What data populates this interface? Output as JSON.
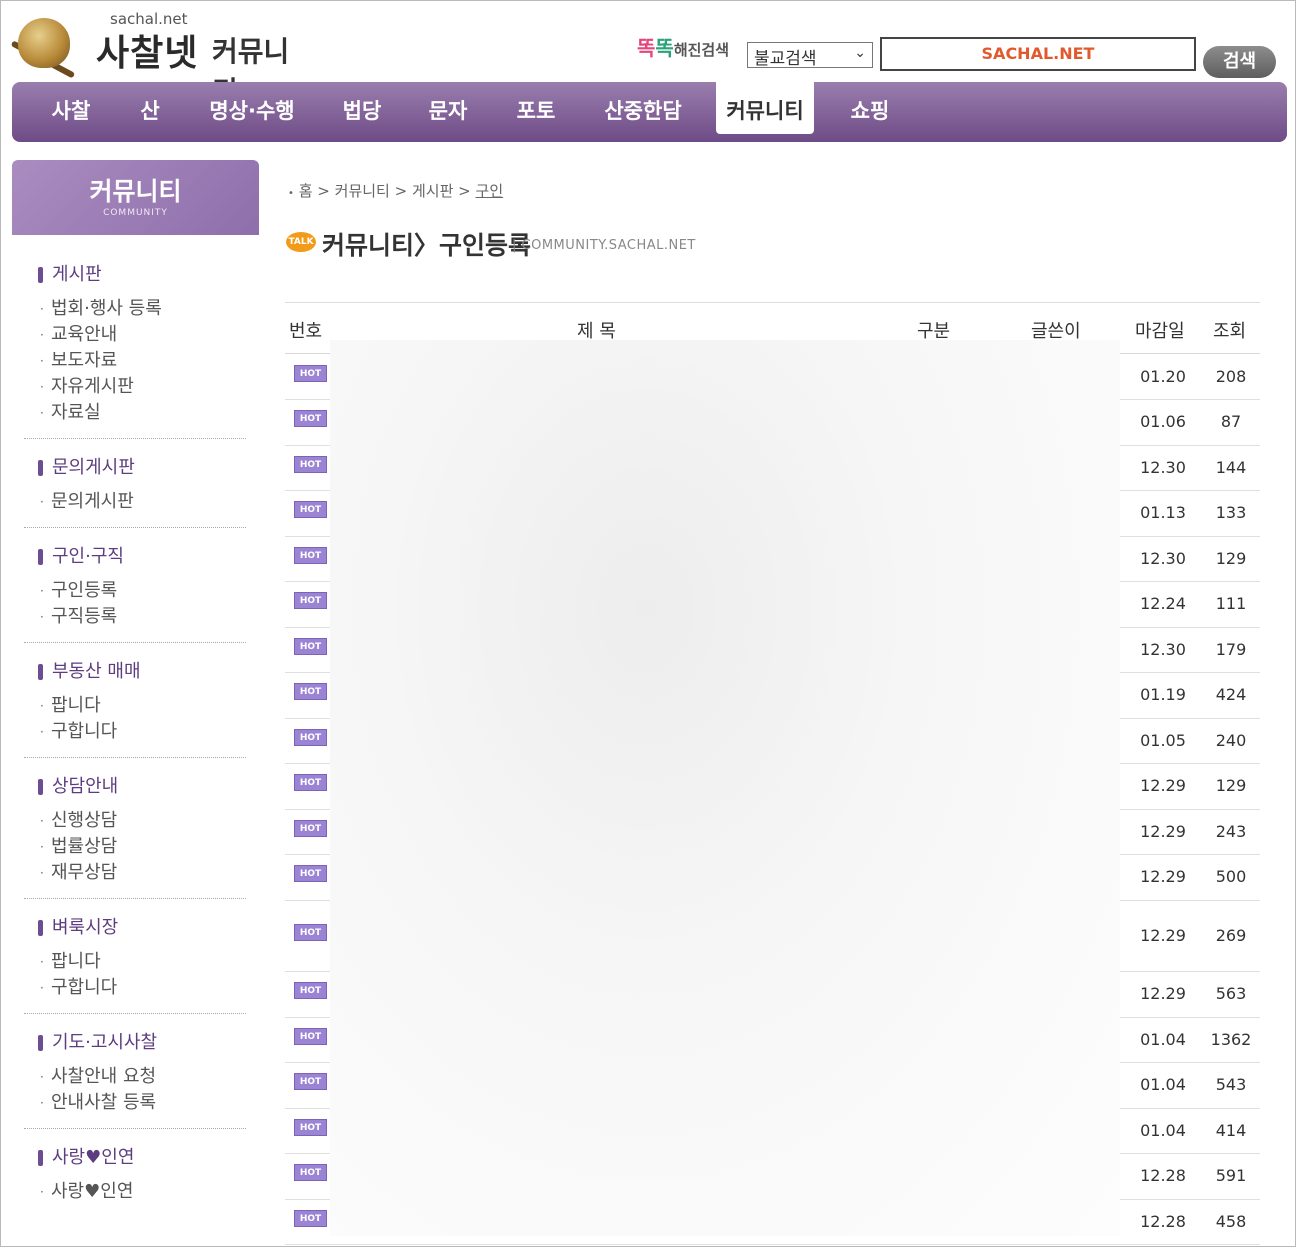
{
  "header": {
    "logo_small": "sachal.net",
    "logo_main": "사찰넷",
    "logo_sub": "커뮤니티",
    "search_brand_tok1": "똑",
    "search_brand_tok2": "똑",
    "search_brand_text": "해진검색",
    "search_select_value": "불교검색",
    "search_input_value": "SACHAL.NET",
    "search_button": "검색"
  },
  "nav": [
    "사찰",
    "산",
    "명상·수행",
    "법당",
    "문자",
    "포토",
    "산중한담",
    "커뮤니티",
    "쇼핑"
  ],
  "sidebar": {
    "banner_title": "커뮤니티",
    "banner_sub": "COMMUNITY",
    "sections": [
      {
        "title": "게시판",
        "items": [
          "법회·행사 등록",
          "교육안내",
          "보도자료",
          "자유게시판",
          "자료실"
        ]
      },
      {
        "title": "문의게시판",
        "items": [
          "문의게시판"
        ]
      },
      {
        "title": "구인·구직",
        "items": [
          "구인등록",
          "구직등록"
        ]
      },
      {
        "title": "부동산 매매",
        "items": [
          "팝니다",
          "구합니다"
        ]
      },
      {
        "title": "상담안내",
        "items": [
          "신행상담",
          "법률상담",
          "재무상담"
        ]
      },
      {
        "title": "벼룩시장",
        "items": [
          "팝니다",
          "구합니다"
        ]
      },
      {
        "title": "기도·고시사찰",
        "items": [
          "사찰안내 요청",
          "안내사찰 등록"
        ]
      },
      {
        "title": "사랑♥인연",
        "items": [
          "사랑♥인연"
        ]
      }
    ]
  },
  "breadcrumb": {
    "bullet": "•",
    "home": "홈",
    "sep": ">",
    "c1": "커뮤니티",
    "c2": "게시판",
    "c3": "구인"
  },
  "page": {
    "talk": "TALK",
    "title": "커뮤니티〉구인등록",
    "sub": "|  COMMUNITY.SACHAL.NET"
  },
  "table": {
    "headers": {
      "no": "번호",
      "title": "제  목",
      "category": "구분",
      "writer": "글쓴이",
      "deadline": "마감일",
      "views": "조회"
    },
    "badge": "HOT",
    "rows": [
      {
        "deadline": "01.20",
        "views": "208"
      },
      {
        "deadline": "01.06",
        "views": "87"
      },
      {
        "deadline": "12.30",
        "views": "144"
      },
      {
        "deadline": "01.13",
        "views": "133"
      },
      {
        "deadline": "12.30",
        "views": "129"
      },
      {
        "deadline": "12.24",
        "views": "111"
      },
      {
        "deadline": "12.30",
        "views": "179"
      },
      {
        "deadline": "01.19",
        "views": "424"
      },
      {
        "deadline": "01.05",
        "views": "240"
      },
      {
        "deadline": "12.29",
        "views": "129"
      },
      {
        "deadline": "12.29",
        "views": "243"
      },
      {
        "deadline": "12.29",
        "views": "500"
      },
      {
        "deadline": "12.29",
        "views": "269"
      },
      {
        "deadline": "12.29",
        "views": "563"
      },
      {
        "deadline": "01.04",
        "views": "1362"
      },
      {
        "deadline": "01.04",
        "views": "543"
      },
      {
        "deadline": "01.04",
        "views": "414"
      },
      {
        "deadline": "12.28",
        "views": "591"
      },
      {
        "deadline": "12.28",
        "views": "458"
      }
    ]
  },
  "colors": {
    "nav": "#7d5a94",
    "accent": "#5d3d80",
    "hot": "#9b84d4",
    "search_text": "#e05a2e"
  }
}
